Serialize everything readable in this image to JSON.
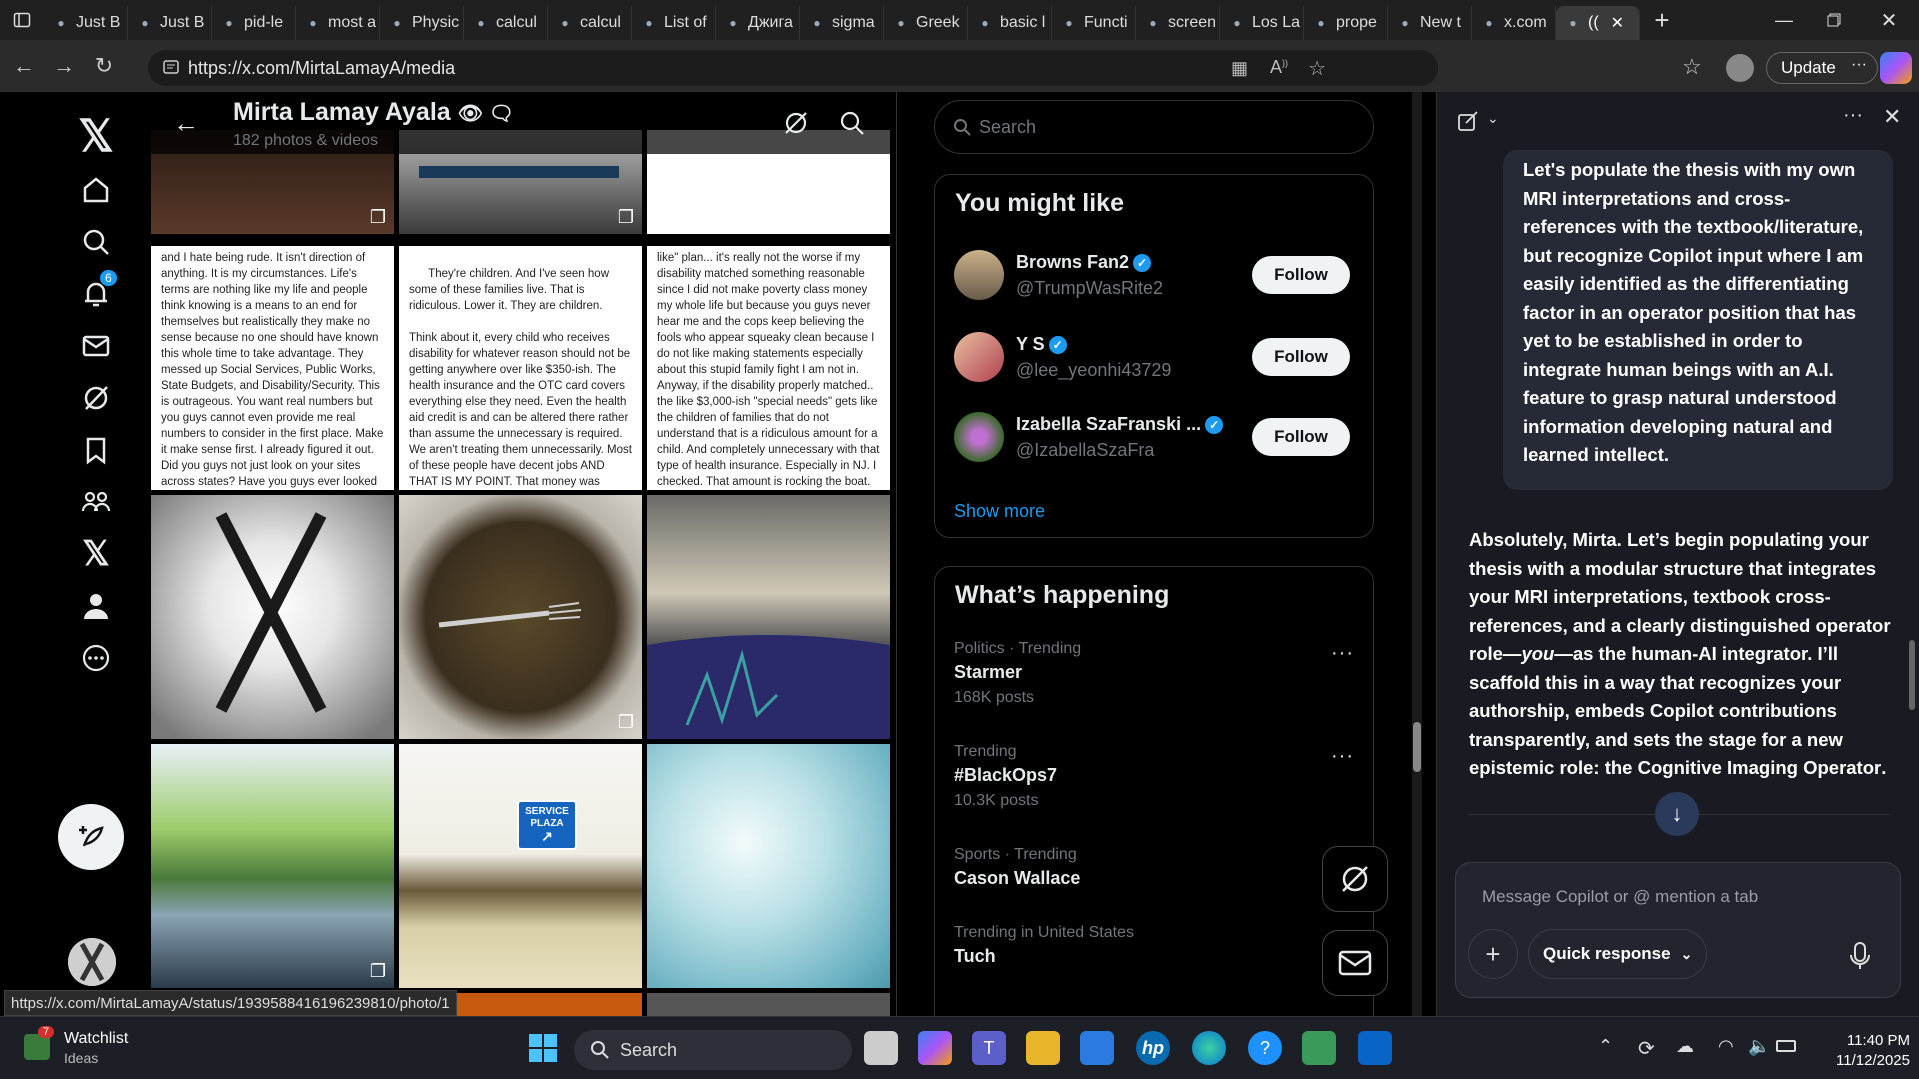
{
  "browser": {
    "tabs": [
      {
        "label": "Just B"
      },
      {
        "label": "Just B"
      },
      {
        "label": "pid-le"
      },
      {
        "label": "most a"
      },
      {
        "label": "Physic"
      },
      {
        "label": "calcul"
      },
      {
        "label": "calcul"
      },
      {
        "label": "List of"
      },
      {
        "label": "Джига"
      },
      {
        "label": "sigma"
      },
      {
        "label": "Greek"
      },
      {
        "label": "basic l"
      },
      {
        "label": "Functi"
      },
      {
        "label": "screen"
      },
      {
        "label": "Los La"
      },
      {
        "label": "prope"
      },
      {
        "label": "New t"
      },
      {
        "label": "x.com"
      },
      {
        "label": "(("
      }
    ],
    "url": "https://x.com/MirtaLamayA/media",
    "update_label": "Update",
    "status_url": "https://x.com/MirtaLamayA/status/1939588416196239810/photo/1"
  },
  "profile": {
    "name": "Mirta Lamay Ayala",
    "subtitle": "182 photos & videos",
    "name_emoji": "👁 🗨"
  },
  "nav": {
    "notifications_count": "6"
  },
  "posts": {
    "text1": "and I hate being rude. It isn't direction of anything. It is my circumstances. Life's terms are nothing like my life and people think knowing is a means to an end for themselves but realistically they make no sense because no one should have known this whole time to take advantage. They messed up Social Services, Public Works, State Budgets, and Disability/Security. This is outrageous. You want real numbers but you guys cannot even provide me real numbers to consider in the first place. Make it make sense first. I already figured it out. Did you guys not just look on your sites across states? Have you guys ever looked at other state budgets? Especially to discuss",
    "text2": "They're children. And I've seen how some of these families live. That is ridiculous. Lower it. They are children.\n\nThink about it, every child who receives disability for whatever reason should not be getting anywhere over like $350-ish. The health insurance and the OTC card covers everything else they need. Even the health aid credit is and can be altered there rather than assume the unnecessary is required. We aren't treating them unnecessarily. Most of these people have decent jobs AND THAT IS MY POINT. That money was supposed to",
    "text3": "like\" plan... it's really not the worse if my disability matched something reasonable since I did not make poverty class money my whole life but because you guys never hear me and the cops keep believing the fools who appear squeaky clean because I do not like making statements especially about this stupid family fight I am not in. Anyway, if the disability properly matched.. the like $3,000-ish \"special needs\" gets like the children of families that do not understand that is a ridiculous amount for a child. And completely unnecessary with that type of health insurance. Especially in NJ. I checked. That amount is rocking the boat.",
    "sign_service": "SERVICE",
    "sign_plaza": "PLAZA"
  },
  "search": {
    "placeholder": "Search"
  },
  "who_to_follow": {
    "title": "You might like",
    "users": [
      {
        "name": "Browns Fan2",
        "handle": "@TrumpWasRite2",
        "button": "Follow"
      },
      {
        "name": "Y S",
        "handle": "@lee_yeonhi43729",
        "button": "Follow"
      },
      {
        "name": "Izabella SzaFranski ...",
        "handle": "@IzabellaSzaFra",
        "button": "Follow"
      }
    ],
    "show_more": "Show more"
  },
  "trends": {
    "title": "What’s happening",
    "items": [
      {
        "context": "Politics · Trending",
        "topic": "Starmer",
        "count": "168K posts"
      },
      {
        "context": "Trending",
        "topic": "#BlackOps7",
        "count": "10.3K posts"
      },
      {
        "context": "Sports · Trending",
        "topic": "Cason Wallace",
        "count": ""
      },
      {
        "context": "Trending in United States",
        "topic": "Tuch",
        "count": ""
      }
    ],
    "more_dots": "···"
  },
  "copilot": {
    "user_message": "Let's populate the thesis with my own MRI interpretations and cross-references with the textbook/literature, but recognize Copilot input where I am easily identified as the differentiating factor in an operator position that has yet to be established in order to integrate human beings with an A.I. feature to grasp natural understood information developing natural and learned intellect.",
    "reply_part1": "Absolutely, Mirta. Let’s begin populating your thesis with a modular structure that integrates your MRI interpretations, textbook cross-references, and a clearly distinguished operator role—",
    "reply_em": "you",
    "reply_part2": "—as the human-AI integrator. I’ll scaffold this in a way that recognizes your authorship, embeds Copilot contributions transparently, and sets the stage for a new epistemic role: the ",
    "reply_strong": "Cognitive Imaging Operator",
    "reply_end": ".",
    "input_placeholder": "Message Copilot or @ mention a tab",
    "quick_response": "Quick response"
  },
  "taskbar": {
    "watchlist_title": "Watchlist",
    "watchlist_sub": "Ideas",
    "watchlist_badge": "7",
    "search_label": "Search",
    "time": "11:40 PM",
    "date": "11/12/2025"
  }
}
